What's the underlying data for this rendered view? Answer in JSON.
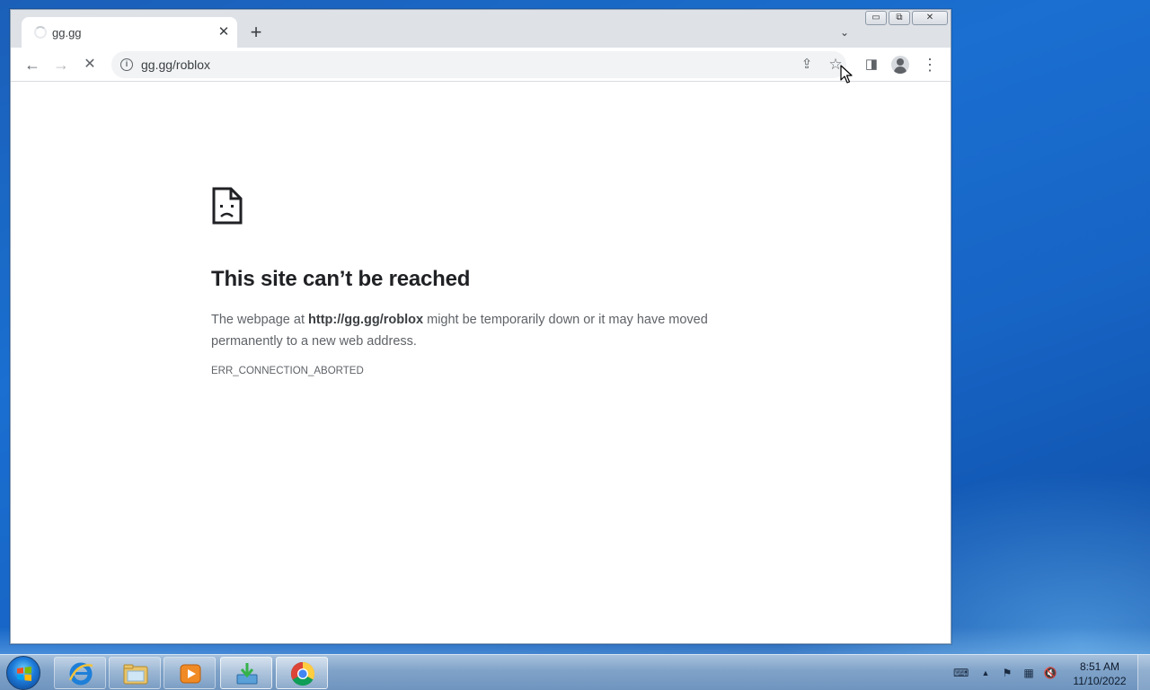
{
  "browser": {
    "tab": {
      "title": "gg.gg",
      "close": "✕"
    },
    "new_tab": "+",
    "tab_search": "⌄",
    "window_controls": {
      "minimize": "▭",
      "maximize": "⧉",
      "close": "✕"
    },
    "nav": {
      "back": "←",
      "forward": "→",
      "stop": "✕"
    },
    "address_bar": {
      "url": "gg.gg/roblox"
    },
    "icons": {
      "site_info": "i",
      "share": "⇪",
      "bookmark": "☆",
      "side_panel": "◨",
      "menu": "⋮"
    }
  },
  "error_page": {
    "title": "This site can’t be reached",
    "desc_prefix": "The webpage at ",
    "desc_url": "http://gg.gg/roblox",
    "desc_suffix": " might be temporarily down or it may have moved permanently to a new web address.",
    "error_code": "ERR_CONNECTION_ABORTED"
  },
  "taskbar": {
    "apps": [
      "internet-explorer",
      "windows-explorer",
      "media-player",
      "app-installer",
      "chrome"
    ],
    "tray": {
      "keyboard": "⌨",
      "show_hidden": "▲",
      "flag": "⚑",
      "network": "▦",
      "volume": "🔇"
    },
    "clock": {
      "time": "8:51 AM",
      "date": "11/10/2022"
    }
  },
  "colors": {
    "desktop": "#1a6fd0",
    "tabstrip": "#dee1e6",
    "title_text": "#202124",
    "body_text": "#5f6368"
  }
}
